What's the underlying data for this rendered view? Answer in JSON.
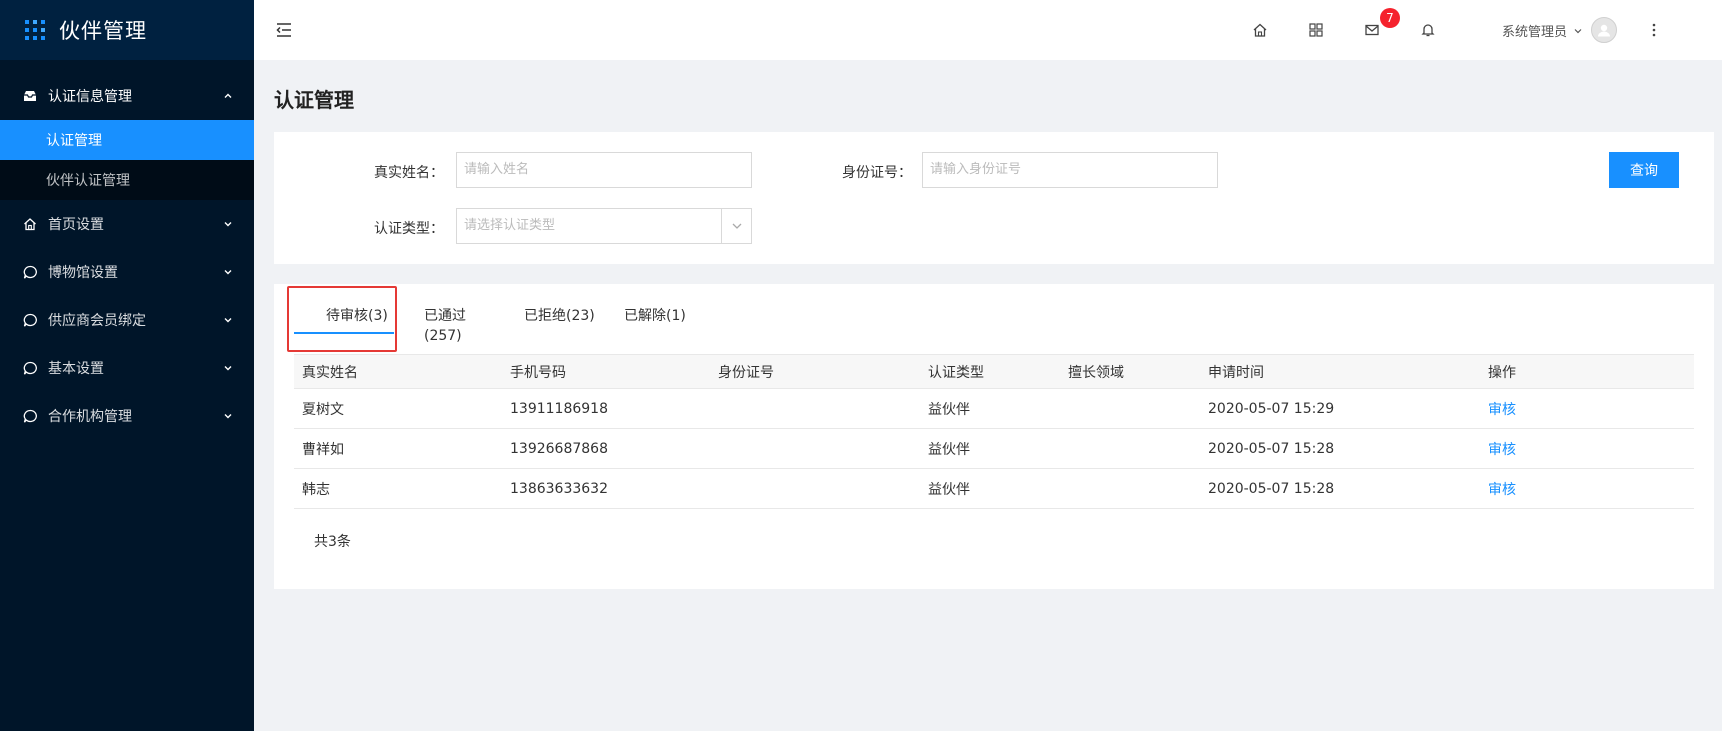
{
  "app": {
    "title": "伙伴管理"
  },
  "sidebar": {
    "groups": [
      {
        "label": "认证信息管理",
        "icon": "inbox-icon",
        "expanded": true,
        "items": [
          {
            "label": "认证管理",
            "active": true
          },
          {
            "label": "伙伴认证管理",
            "active": false
          }
        ]
      },
      {
        "label": "首页设置",
        "icon": "home-icon",
        "expanded": false
      },
      {
        "label": "博物馆设置",
        "icon": "chat-icon",
        "expanded": false
      },
      {
        "label": "供应商会员绑定",
        "icon": "chat-icon",
        "expanded": false
      },
      {
        "label": "基本设置",
        "icon": "chat-icon",
        "expanded": false
      },
      {
        "label": "合作机构管理",
        "icon": "chat-icon",
        "expanded": false
      }
    ]
  },
  "header": {
    "mail_badge": "7",
    "user_name": "系统管理员"
  },
  "page": {
    "title": "认证管理"
  },
  "search": {
    "name_label": "真实姓名：",
    "name_placeholder": "请输入姓名",
    "id_label": "身份证号：",
    "id_placeholder": "请输入身份证号",
    "type_label": "认证类型：",
    "type_placeholder": "请选择认证类型",
    "query_label": "查询"
  },
  "tabs": [
    {
      "label": "待审核(3)",
      "active": true
    },
    {
      "label_line1": "已通过",
      "label_line2": "(257)"
    },
    {
      "label": "已拒绝(23)"
    },
    {
      "label": "已解除(1)"
    }
  ],
  "table": {
    "columns": [
      "真实姓名",
      "手机号码",
      "身份证号",
      "认证类型",
      "擅长领域",
      "申请时间",
      "操作"
    ],
    "rows": [
      {
        "name": "夏树文",
        "phone": "13911186918",
        "id_no": "",
        "type": "益伙伴",
        "field": "",
        "time": "2020-05-07 15:29",
        "action": "审核"
      },
      {
        "name": "曹祥如",
        "phone": "13926687868",
        "id_no": "",
        "type": "益伙伴",
        "field": "",
        "time": "2020-05-07 15:28",
        "action": "审核"
      },
      {
        "name": "韩志",
        "phone": "13863633632",
        "id_no": "",
        "type": "益伙伴",
        "field": "",
        "time": "2020-05-07 15:28",
        "action": "审核"
      }
    ],
    "total_text": "共3条"
  },
  "colors": {
    "primary": "#1890ff",
    "sidebar_bg": "#001529",
    "highlight": "#e53935",
    "badge": "#f5222d"
  }
}
